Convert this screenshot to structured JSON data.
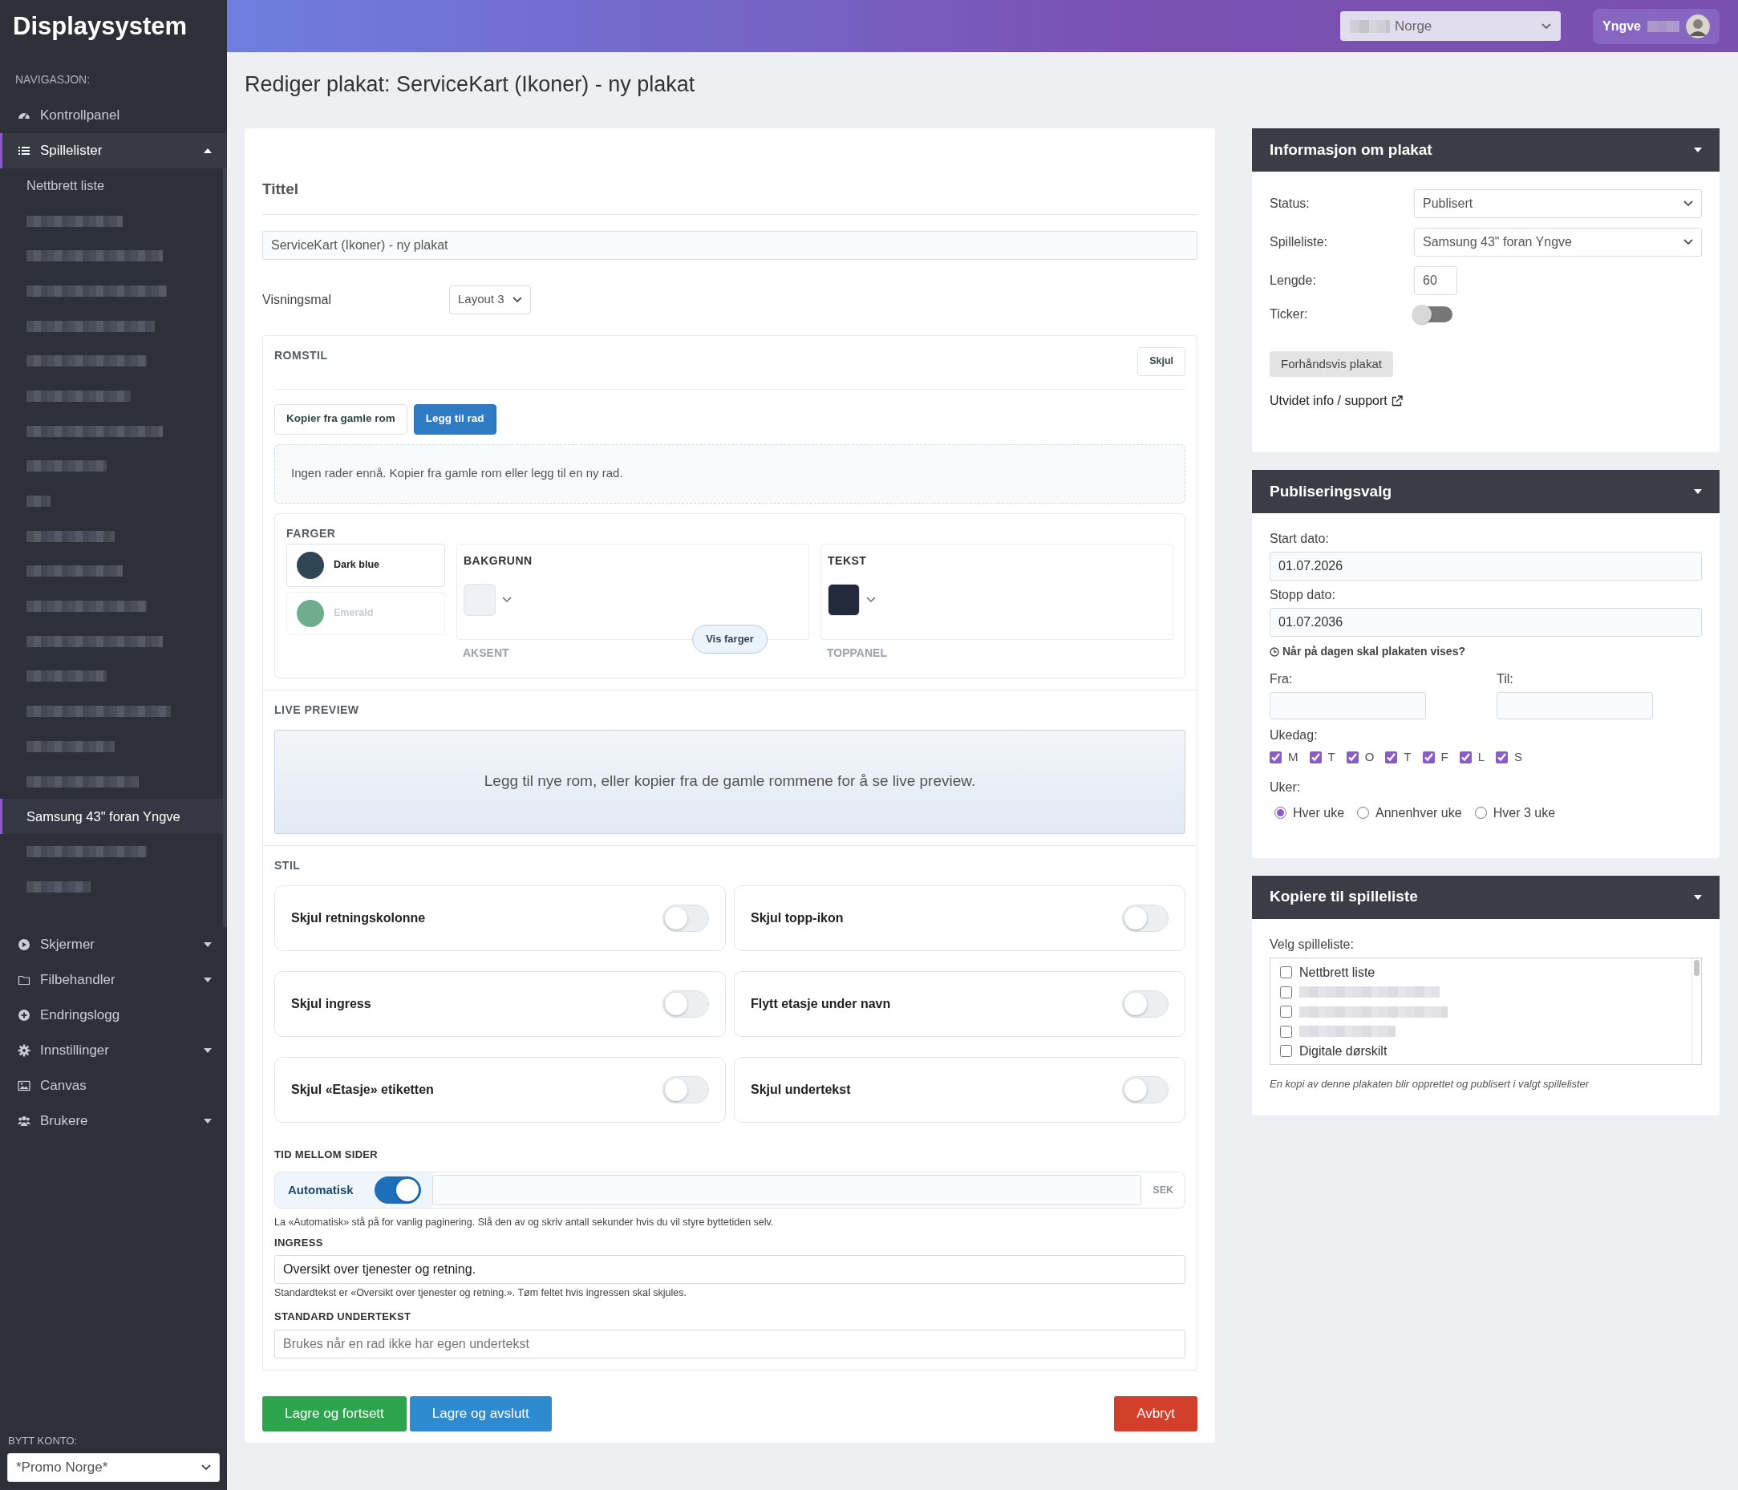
{
  "sidebar": {
    "brand": "Displaysystem",
    "nav_heading": "NAVIGASJON:",
    "items": [
      {
        "label": "Kontrollpanel",
        "kind": "link",
        "selected": false
      },
      {
        "label": "Spillelister",
        "kind": "group",
        "expanded": true,
        "selected": true,
        "children": [
          {
            "kind": "text",
            "label": "Nettbrett liste",
            "selected": false
          },
          {
            "kind": "redacted",
            "selected": false
          },
          {
            "kind": "redacted",
            "selected": false
          },
          {
            "kind": "redacted",
            "selected": false
          },
          {
            "kind": "redacted",
            "selected": false
          },
          {
            "kind": "redacted",
            "selected": false
          },
          {
            "kind": "redacted",
            "selected": false
          },
          {
            "kind": "redacted",
            "selected": false
          },
          {
            "kind": "redacted",
            "selected": false
          },
          {
            "kind": "redacted",
            "selected": false
          },
          {
            "kind": "redacted",
            "selected": false
          },
          {
            "kind": "redacted",
            "selected": false
          },
          {
            "kind": "redacted",
            "selected": false
          },
          {
            "kind": "redacted",
            "selected": false
          },
          {
            "kind": "redacted",
            "selected": false
          },
          {
            "kind": "redacted",
            "selected": false
          },
          {
            "kind": "redacted",
            "selected": false
          },
          {
            "kind": "redacted",
            "selected": false
          },
          {
            "kind": "text",
            "label": "Samsung 43\" foran Yngve",
            "selected": true
          },
          {
            "kind": "redacted",
            "selected": false
          },
          {
            "kind": "redacted",
            "selected": false
          }
        ]
      },
      {
        "label": "Skjermer",
        "kind": "group",
        "expanded": false,
        "selected": false
      },
      {
        "label": "Filbehandler",
        "kind": "group",
        "expanded": false,
        "selected": false
      },
      {
        "label": "Endringslogg",
        "kind": "link",
        "selected": false
      },
      {
        "label": "Innstillinger",
        "kind": "group",
        "expanded": false,
        "selected": false
      },
      {
        "label": "Canvas",
        "kind": "link",
        "selected": false
      },
      {
        "label": "Brukere",
        "kind": "group",
        "expanded": false,
        "selected": false
      }
    ],
    "account": {
      "label": "BYTT KONTO:",
      "value": "*Promo Norge*"
    }
  },
  "topbar": {
    "account_select": "Norge",
    "user": "Yngve"
  },
  "page_title": "Rediger plakat: ServiceKart (Ikoner) - ny plakat",
  "form": {
    "title_heading": "Tittel",
    "title_value": "ServiceKart (Ikoner) - ny plakat",
    "template_label": "Visningsmal",
    "template_value": "Layout 3",
    "romstil": {
      "heading": "ROMSTIL",
      "hide_button": "Skjul",
      "buttons": [
        {
          "label": "Kopier fra gamle rom",
          "kind": "secondary"
        },
        {
          "label": "Legg til rad",
          "kind": "primary"
        }
      ],
      "empty_message": "Ingen rader ennå. Kopier fra gamle rom eller legg til en ny rad.",
      "colors": {
        "heading": "FARGER",
        "presets": [
          {
            "name": "Dark blue",
            "color": "#2e4656",
            "selected": true
          },
          {
            "name": "Emerald",
            "color": "#6fae8c",
            "selected": false
          }
        ],
        "groups": [
          {
            "label": "BAKGRUNN",
            "color": "#eef1f6"
          },
          {
            "label": "TEKST",
            "color": "#222a3c"
          }
        ],
        "faded_labels": [
          "AKSENT",
          "TOPPANEL"
        ],
        "more_button": "Vis farger"
      }
    },
    "live_preview": {
      "heading": "LIVE PREVIEW",
      "message": "Legg til nye rom, eller kopier fra de gamle rommene for å se live preview."
    },
    "stil": {
      "heading": "STIL",
      "toggles": [
        {
          "label": "Skjul retningskolonne",
          "on": false
        },
        {
          "label": "Skjul topp-ikon",
          "on": false
        },
        {
          "label": "Skjul ingress",
          "on": false
        },
        {
          "label": "Flytt etasje under navn",
          "on": false
        },
        {
          "label": "Skjul «Etasje» etiketten",
          "on": false
        },
        {
          "label": "Skjul undertekst",
          "on": false
        }
      ]
    },
    "timing": {
      "heading": "TID MELLOM SIDER",
      "toggle_label": "Automatisk",
      "on": true,
      "unit": "SEK",
      "help": "La «Automatisk» stå på for vanlig paginering. Slå den av og skriv antall sekunder hvis du vil styre byttetiden selv."
    },
    "ingress": {
      "label": "INGRESS",
      "value": "Oversikt over tjenester og retning.",
      "help": "Standardtekst er «Oversikt over tjenester og retning.». Tøm feltet hvis ingressen skal skjules."
    },
    "subtitle": {
      "label": "STANDARD UNDERTEKST",
      "placeholder": "Brukes når en rad ikke har egen undertekst"
    },
    "actions": [
      {
        "label": "Lagre og fortsett",
        "kind": "success"
      },
      {
        "label": "Lagre og avslutt",
        "kind": "primary"
      },
      {
        "label": "Avbryt",
        "kind": "danger"
      }
    ]
  },
  "info_panel": {
    "title": "Informasjon om plakat",
    "status_label": "Status:",
    "status": "Publisert",
    "playlist_label": "Spilleliste:",
    "playlist": "Samsung 43\" foran Yngve",
    "length_label": "Lengde:",
    "length": "60",
    "ticker_label": "Ticker:",
    "ticker_on": false,
    "preview_button": "Forhåndsvis plakat",
    "support_link": "Utvidet info / support"
  },
  "publish_panel": {
    "title": "Publiseringsvalg",
    "start_label": "Start dato:",
    "start": "01.07.2026",
    "stop_label": "Stopp dato:",
    "stop": "01.07.2036",
    "time_question": "Når på dagen skal plakaten vises?",
    "from_label": "Fra:",
    "to_label": "Til:",
    "weekday_label": "Ukedag:",
    "weekdays": [
      {
        "label": "M",
        "checked": true
      },
      {
        "label": "T",
        "checked": true
      },
      {
        "label": "O",
        "checked": true
      },
      {
        "label": "T",
        "checked": true
      },
      {
        "label": "F",
        "checked": true
      },
      {
        "label": "L",
        "checked": true
      },
      {
        "label": "S",
        "checked": true
      }
    ],
    "weeks_label": "Uker:",
    "weeks": [
      {
        "label": "Hver uke",
        "selected": true
      },
      {
        "label": "Annenhver uke",
        "selected": false
      },
      {
        "label": "Hver 3 uke",
        "selected": false
      }
    ]
  },
  "copy_panel": {
    "title": "Kopiere til spilleliste",
    "label": "Velg spilleliste:",
    "items": [
      {
        "kind": "text",
        "label": "Nettbrett liste",
        "checked": false
      },
      {
        "kind": "redacted",
        "checked": false
      },
      {
        "kind": "redacted",
        "checked": false
      },
      {
        "kind": "redacted",
        "checked": false
      },
      {
        "kind": "text",
        "label": "Digitale dørskilt",
        "checked": false
      }
    ],
    "note": "En kopi av denne plakaten blir opprettet og publisert i valgt spillelister"
  }
}
